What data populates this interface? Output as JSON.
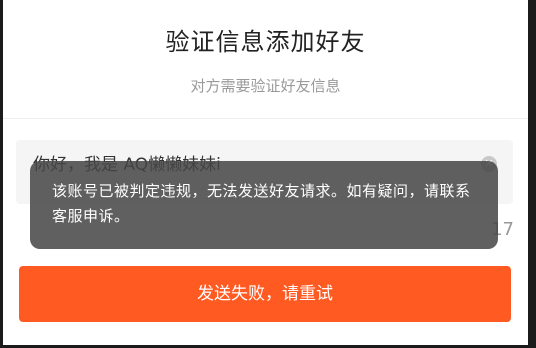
{
  "dialog": {
    "title": "验证信息添加好友",
    "subtitle": "对方需要验证好友信息"
  },
  "message_field": {
    "value": "你好，我是 AQ懒懒妹妹i",
    "clear_icon": "clear-circle-icon",
    "char_count": "17"
  },
  "send_button": {
    "label": "发送失败，请重试",
    "color": "#ff5a22"
  },
  "toast": {
    "text": "该账号已被判定违规，无法发送好友请求。如有疑问，请联系客服申诉。"
  }
}
